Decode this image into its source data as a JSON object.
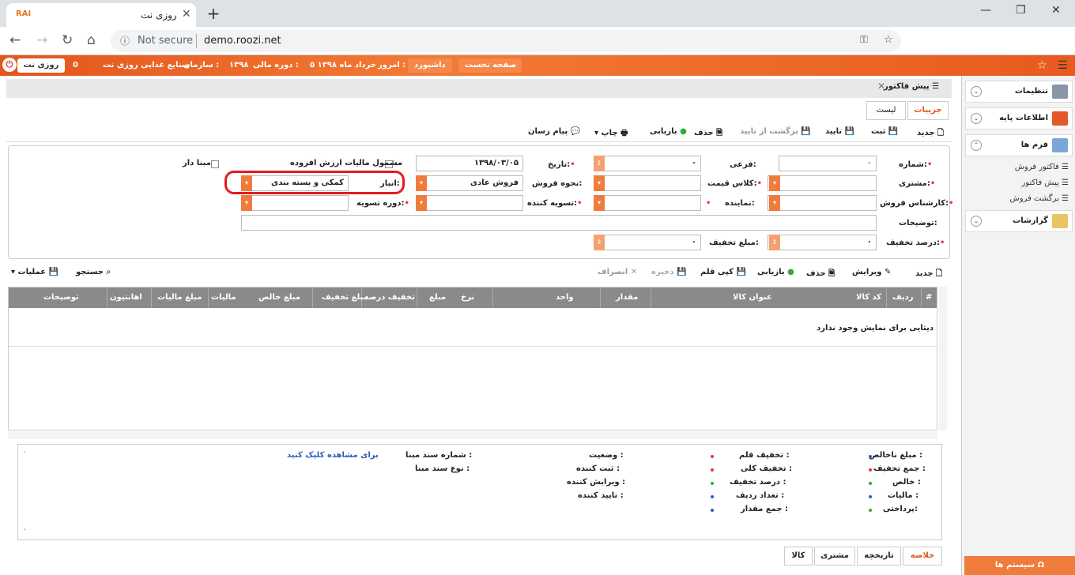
{
  "browser": {
    "tab_title": "روزی نت",
    "tab_logo": "RAI",
    "url_security": "Not secure",
    "url_host": "demo.roozi.net"
  },
  "topbar": {
    "brand": "روزی نت",
    "org_label": "سازمان :",
    "org_value": "صنایع غذایی روزی نت",
    "fiscal_label": "دوره مالی :",
    "fiscal_value": "۱۳۹۸",
    "today_label": "امروز :",
    "today_value": "۵ خرداد ماه ۱۳۹۸",
    "dashboard": "داشبورد",
    "home": "صفحه نخست",
    "zero": "0"
  },
  "sidebar": {
    "settings": "تنظیمات",
    "basic_info": "اطلاعات پایه",
    "forms": "فرم ها",
    "sub_items": [
      "فاکتور فروش",
      "پیش فاکتور",
      "برگشت فروش"
    ],
    "reports": "گزارشات",
    "system": "سیستم ها"
  },
  "document": {
    "title": "پیش فاکتور",
    "tab_details": "جزییات",
    "tab_list": "لیست"
  },
  "toolbar": {
    "new": "جدید",
    "save": "ثبت",
    "confirm": "تایید",
    "unconfirm": "برگشت از تایید",
    "delete": "حذف",
    "refresh": "بازیابی",
    "print": "چاپ",
    "messenger": "پیام رسان"
  },
  "form": {
    "number_label": "شماره:",
    "number_value": "۰",
    "sub_label": "فرعی:",
    "sub_value": "۰",
    "date_label": "تاریخ:",
    "date_value": "۱۳۹۸/۰۳/۰۵",
    "vat_label": "مشمول مالیات ارزش افزوده",
    "based_label": "مبنا دار",
    "customer_label": "مشتری:",
    "price_class_label": "کلاس قیمت:",
    "sale_method_label": "نحوه فروش:",
    "sale_method_value": "فروش عادی",
    "warehouse_label": "انبار:",
    "warehouse_value": "کمکی و بسته بندی",
    "sales_expert_label": "کارشناس فروش:",
    "representative_label": "نماینده:",
    "settler_label": "تسویه کننده:",
    "settle_period_label": "دوره تسویه:",
    "description_label": "توضیحات:",
    "discount_pct_label": "درصد تخفیف:",
    "discount_pct_value": "۰",
    "discount_amt_label": "مبلغ تخفیف:",
    "discount_amt_value": "۰"
  },
  "grid_toolbar": {
    "new": "جدید",
    "edit": "ویرایش",
    "delete": "حذف",
    "refresh": "بازیابی",
    "copy": "کپی قلم",
    "save": "ذخیره",
    "cancel": "انصراف",
    "search": "جستجو",
    "operations": "عملیات"
  },
  "grid": {
    "columns": [
      "#",
      "ردیف",
      "کد کالا",
      "عنوان کالا",
      "مقدار",
      "واحد",
      "نرخ",
      "مبلغ",
      "تخفیف درصد",
      "مبلغ تخفیف",
      "مبلغ خالص",
      "مالیات",
      "مبلغ مالیات",
      "اهانتیون",
      "توضیحات"
    ],
    "empty_text": "دیتایی برای نمایش وجود ندارد"
  },
  "summary": {
    "col1": [
      "مبلغ ناخالص :",
      "جمع تخفیف :",
      "خالص :",
      "مالیات :",
      "پرداختی:"
    ],
    "col2": [
      "تخفیف قلم :",
      "تخفیف کلی :",
      "درصد تخفیف :",
      "تعداد ردیف :",
      "جمع مقدار :"
    ],
    "col3": [
      "وضعیت :",
      "ثبت کننده :",
      "ویرایش کننده :",
      "تایید کننده :"
    ],
    "col4": [
      "شماره سند مبنا :",
      "نوع سند مبنا :"
    ],
    "view_link": "برای مشاهده کلیک کنید"
  },
  "bottom_tabs": [
    "خلاصه",
    "تاریخچه",
    "مشتری",
    "کالا"
  ],
  "colors": {
    "accent": "#f07c3c",
    "header_gray": "#8a8a8a",
    "required": "#e33333",
    "highlight": "#e01d1d"
  }
}
